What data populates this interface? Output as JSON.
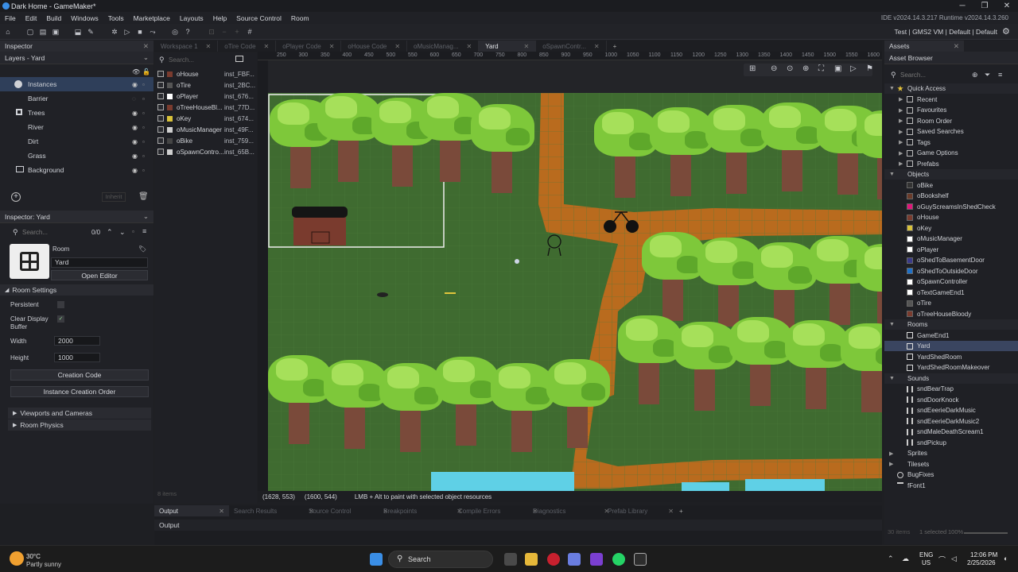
{
  "window": {
    "title": "Dark Home - GameMaker*",
    "ide_version": "IDE v2024.14.3.217  Runtime v2024.14.3.260"
  },
  "menu": [
    "File",
    "Edit",
    "Build",
    "Windows",
    "Tools",
    "Marketplace",
    "Layouts",
    "Help",
    "Source Control",
    "Room"
  ],
  "config": {
    "label": "Test | GMS2 VM | Default | Default"
  },
  "inspector": {
    "tab": "Inspector",
    "layers_dropdown": "Layers - Yard",
    "layers": [
      {
        "name": "Instances",
        "icon": "instance-layer-icon"
      },
      {
        "name": "Barrier",
        "icon": ""
      },
      {
        "name": "Trees",
        "icon": "tile-layer-icon"
      },
      {
        "name": "River",
        "icon": ""
      },
      {
        "name": "Dirt",
        "icon": ""
      },
      {
        "name": "Grass",
        "icon": ""
      },
      {
        "name": "Background",
        "icon": "background-layer-icon"
      }
    ],
    "inherit_label": "Inherit",
    "inspector2_dropdown": "Inspector: Yard",
    "search_placeholder": "Search...",
    "search_count": "0/0",
    "room_label": "Room",
    "room_name": "Yard",
    "open_editor": "Open Editor",
    "room_settings": "Room Settings",
    "persistent": "Persistent",
    "clear_display": "Clear Display Buffer",
    "width_label": "Width",
    "width_value": "2000",
    "height_label": "Height",
    "height_value": "1000",
    "creation_code": "Creation Code",
    "instance_creation_order": "Instance Creation Order",
    "viewports": "Viewports and Cameras",
    "physics": "Room Physics"
  },
  "object_list": {
    "search_placeholder": "Search...",
    "items": [
      {
        "name": "oHouse",
        "inst": "inst_FBF...",
        "color": "#7a3b2e"
      },
      {
        "name": "oTire",
        "inst": "inst_2BC...",
        "color": "#555"
      },
      {
        "name": "oPlayer",
        "inst": "inst_676...",
        "color": "#ffffff"
      },
      {
        "name": "oTreeHouseBl...",
        "inst": "inst_77D...",
        "color": "#7a3b2e"
      },
      {
        "name": "oKey",
        "inst": "inst_674...",
        "color": "#d9c23a"
      },
      {
        "name": "oMusicManager",
        "inst": "inst_49F...",
        "color": "#cfcfcf"
      },
      {
        "name": "oBike",
        "inst": "inst_759...",
        "color": "#444"
      },
      {
        "name": "oSpawnContro...",
        "inst": "inst_65B...",
        "color": "#cfcfcf"
      }
    ],
    "items_count": "8 items"
  },
  "room_tabs": [
    {
      "label": "Workspace 1",
      "active": false
    },
    {
      "label": "oTire Code",
      "active": false
    },
    {
      "label": "oPlayer Code",
      "active": false
    },
    {
      "label": "oHouse Code",
      "active": false
    },
    {
      "label": "oMusicManag...",
      "active": false
    },
    {
      "label": "Yard",
      "active": true
    },
    {
      "label": "oSpawnContr...",
      "active": false
    }
  ],
  "ruler_ticks": [
    "250",
    "300",
    "350",
    "400",
    "450",
    "500",
    "550",
    "600",
    "650",
    "700",
    "750",
    "800",
    "850",
    "900",
    "950",
    "1000",
    "1050",
    "1100",
    "1150",
    "1200",
    "1250",
    "1300",
    "1350",
    "1400",
    "1450",
    "1500",
    "1550",
    "1600"
  ],
  "room_status": {
    "cursor": "(1628, 553)",
    "size": "(1600, 544)",
    "hint": "LMB + Alt to paint with selected object resources"
  },
  "bottom": {
    "tabs": [
      "Output",
      "Search Results",
      "Source Control",
      "Breakpoints",
      "Compile Errors",
      "Diagnostics",
      "Prefab Library"
    ],
    "panel_title": "Output"
  },
  "assets": {
    "tab": "Assets",
    "browser": "Asset Browser",
    "search_placeholder": "Search...",
    "quick_access": "Quick Access",
    "quick_items": [
      "Recent",
      "Favourites",
      "Room Order",
      "Saved Searches",
      "Tags",
      "Game Options",
      "Prefabs"
    ],
    "objects_header": "Objects",
    "objects": [
      {
        "name": "oBike",
        "color": "#333"
      },
      {
        "name": "oBookshelf",
        "color": "#6b3b2a"
      },
      {
        "name": "oGuyScreamsInShedCheck",
        "color": "#e0167a"
      },
      {
        "name": "oHouse",
        "color": "#7a3b2e"
      },
      {
        "name": "oKey",
        "color": "#d9c23a"
      },
      {
        "name": "oMusicManager",
        "color": "#ffffff"
      },
      {
        "name": "oPlayer",
        "color": "#ffffff"
      },
      {
        "name": "oShedToBasementDoor",
        "color": "#3a3a8a"
      },
      {
        "name": "oShedToOutsideDoor",
        "color": "#1e70c8"
      },
      {
        "name": "oSpawnController",
        "color": "#ffffff"
      },
      {
        "name": "oTextGameEnd1",
        "color": "#ffffff"
      },
      {
        "name": "oTire",
        "color": "#555"
      },
      {
        "name": "oTreeHouseBloody",
        "color": "#7a3b2e"
      }
    ],
    "rooms_header": "Rooms",
    "rooms": [
      "GameEnd1",
      "Yard",
      "YardShedRoom",
      "YardShedRoomMakeover"
    ],
    "selected_room": "Yard",
    "sounds_header": "Sounds",
    "sounds": [
      "sndBearTrap",
      "sndDoorKnock",
      "sndEeerieDarkMusic",
      "sndEeerieDarkMusic2",
      "sndMaleDeathScream1",
      "sndPickup"
    ],
    "others": [
      "Sprites",
      "Tilesets",
      "BugFixes",
      "fFont1"
    ],
    "footer_count": "30 items",
    "footer_sel": "1 selected",
    "footer_zoom": "100%"
  },
  "taskbar": {
    "weather_temp": "30°C",
    "weather_desc": "Partly sunny",
    "search": "Search",
    "lang": "ENG",
    "region": "US",
    "time": "12:06 PM",
    "date": "2/25/2026"
  }
}
